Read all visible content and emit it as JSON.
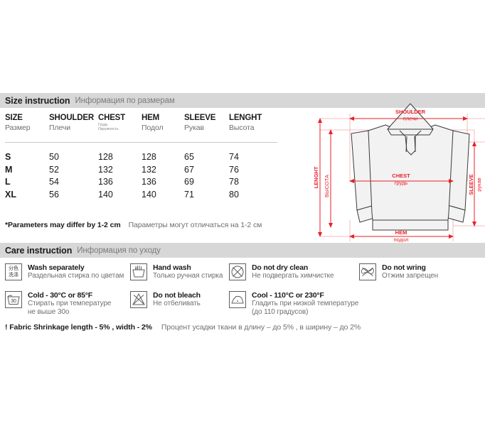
{
  "sections": {
    "size": {
      "title_en": "Size instruction",
      "title_ru": "Информация по размерам"
    },
    "care": {
      "title_en": "Care instruction",
      "title_ru": "Информация по уходу"
    }
  },
  "size_table": {
    "columns": [
      {
        "en": "SIZE",
        "ru": "Размер"
      },
      {
        "en": "SHOULDER",
        "ru": "Плечи"
      },
      {
        "en": "CHEST",
        "ru": "Грудь",
        "ru2": "Окружность"
      },
      {
        "en": "HEM",
        "ru": "Подол"
      },
      {
        "en": "SLEEVE",
        "ru": "Рукав"
      },
      {
        "en": "LENGHT",
        "ru": "Высота"
      }
    ],
    "rows": [
      {
        "size": "S",
        "shoulder": "50",
        "chest": "128",
        "hem": "128",
        "sleeve": "65",
        "lenght": "74"
      },
      {
        "size": "M",
        "shoulder": "52",
        "chest": "132",
        "hem": "132",
        "sleeve": "67",
        "lenght": "76"
      },
      {
        "size": "L",
        "shoulder": "54",
        "chest": "136",
        "hem": "136",
        "sleeve": "69",
        "lenght": "78"
      },
      {
        "size": "XL",
        "shoulder": "56",
        "chest": "140",
        "hem": "140",
        "sleeve": "71",
        "lenght": "80"
      }
    ],
    "note_en": "*Parameters may differ by 1-2 cm",
    "note_ru": "Параметры могут отличаться на 1-2 см"
  },
  "care_items": [
    {
      "icon": "wash-separately-icon",
      "cjk_top": "分色",
      "cjk_bottom": "洗涤",
      "en": "Wash separately",
      "ru": "Раздельная стирка по цветам",
      "ru2": ""
    },
    {
      "icon": "hand-wash-icon",
      "en": "Hand wash",
      "ru": "Только ручная стирка",
      "ru2": ""
    },
    {
      "icon": "do-not-dry-clean-icon",
      "en": "Do not dry clean",
      "ru": "Не подвергать химчистке",
      "ru2": ""
    },
    {
      "icon": "do-not-wring-icon",
      "en": "Do not wring",
      "ru": "Отжим запрещен",
      "ru2": ""
    },
    {
      "icon": "wash-30-icon",
      "temp": "30",
      "en": "Cold - 30°C or 85°F",
      "ru": "Стирать при температуре",
      "ru2": "не выше 30о"
    },
    {
      "icon": "do-not-bleach-icon",
      "en": "Do not bleach",
      "ru": "Не отбеливать",
      "ru2": ""
    },
    {
      "icon": "iron-cool-icon",
      "en": "Cool - 110°C or 230°F",
      "ru": "Гладить при низкой температуре",
      "ru2": "(до 110 градусов)"
    }
  ],
  "shrinkage": {
    "en": "!  Fabric Shrinkage length - 5% , width - 2%",
    "ru": "Процент усадки ткани в длину – до 5% , в ширину – до 2%"
  },
  "diagram": {
    "labels": {
      "shoulder_en": "SHOULDER",
      "shoulder_ru": "плечи",
      "chest_en": "CHEST",
      "chest_ru": "грудь",
      "hem_en": "HEM",
      "hem_ru": "подол",
      "sleeve_en": "SLEEVE",
      "sleeve_ru": "рукав",
      "lenght_en": "LENGHT",
      "lenght_ru": "ВЫСОТА"
    }
  },
  "colors": {
    "header_bar": "#d7d7d7",
    "accent_red": "#e8202a",
    "measure_line": "#f0a6ad",
    "text_dark": "#1b1b1b",
    "text_gray": "#6f6f6f",
    "garment_fill": "#f2f2f2"
  }
}
